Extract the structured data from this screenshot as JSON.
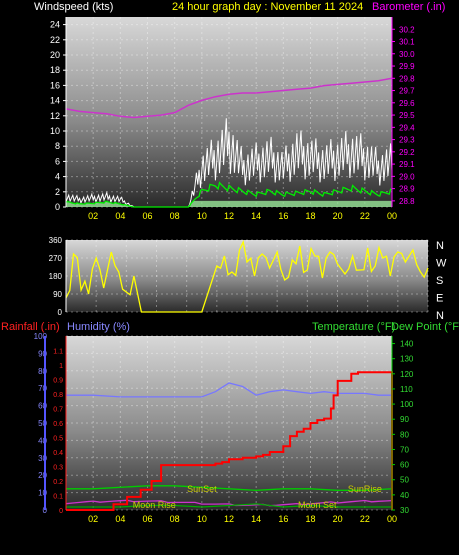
{
  "header": {
    "wind_label": "Windspeed (kts)",
    "title": "24 hour graph day : November 11 2024",
    "baro_label": "Barometer (.in)"
  },
  "bottom_labels": {
    "rainfall": "Rainfall (.in)",
    "humidity": "Humidity (%)",
    "temperature": "Temperature (°F)",
    "dewpoint": "Dew Point (°F)"
  },
  "colors": {
    "wind_gust": "#ffffff",
    "wind_avg": "#00ee00",
    "wind_fill": "#99e699",
    "baro": "#cc33cc",
    "direction": "#ffff00",
    "rain": "#ff0000",
    "humidity": "#7777ff",
    "temperature": "#00cc00",
    "dewpoint": "#00aa00",
    "lunar": "#cc33cc",
    "time_labels": "#ffff00"
  },
  "chart_data": [
    {
      "type": "line",
      "title": "24 hour graph day : November 11 2024",
      "x_ticks": [
        "02",
        "04",
        "06",
        "08",
        "10",
        "12",
        "14",
        "16",
        "18",
        "20",
        "22",
        "00"
      ],
      "left_axis": {
        "label": "Windspeed (kts)",
        "ylim": [
          0,
          25
        ],
        "ticks": [
          0,
          2,
          4,
          6,
          8,
          10,
          12,
          14,
          16,
          18,
          20,
          22,
          24
        ]
      },
      "right_axis": {
        "label": "Barometer (.in)",
        "ylim": [
          28.75,
          30.3
        ],
        "ticks": [
          28.8,
          28.9,
          29.0,
          29.1,
          29.2,
          29.3,
          29.4,
          29.5,
          29.6,
          29.7,
          29.8,
          29.9,
          30.0,
          30.1,
          30.2
        ]
      },
      "series": [
        {
          "name": "Barometer (.in)",
          "axis": "right",
          "x": [
            0,
            1,
            2,
            3,
            4,
            5,
            6,
            7,
            8,
            9,
            10,
            11,
            12,
            13,
            14,
            15,
            16,
            17,
            18,
            19,
            20,
            21,
            22,
            23,
            24
          ],
          "values": [
            29.55,
            29.53,
            29.52,
            29.51,
            29.49,
            29.48,
            29.49,
            29.5,
            29.52,
            29.58,
            29.62,
            29.65,
            29.67,
            29.68,
            29.68,
            29.69,
            29.7,
            29.71,
            29.72,
            29.74,
            29.75,
            29.76,
            29.77,
            29.78,
            29.8
          ]
        },
        {
          "name": "Windspeed gust (kts)",
          "axis": "left",
          "x": [
            0,
            1,
            2,
            3,
            4,
            5,
            6,
            7,
            8,
            9,
            10,
            11,
            12,
            13,
            14,
            15,
            16,
            17,
            18,
            19,
            20,
            21,
            22,
            23,
            24
          ],
          "values": [
            2,
            1.5,
            1.8,
            2,
            1.5,
            0,
            0,
            0,
            0,
            0,
            8,
            10,
            13,
            8,
            9,
            10,
            8,
            11,
            10,
            9,
            10,
            11,
            10,
            8,
            9
          ]
        },
        {
          "name": "Windspeed avg (kts)",
          "axis": "left",
          "x": [
            0,
            1,
            2,
            3,
            4,
            5,
            6,
            7,
            8,
            9,
            10,
            11,
            12,
            13,
            14,
            15,
            16,
            17,
            18,
            19,
            20,
            21,
            22,
            23,
            24
          ],
          "values": [
            0.8,
            0.5,
            0.6,
            0.8,
            0.5,
            0,
            0,
            0,
            0,
            0,
            2.5,
            3.5,
            3,
            2.5,
            2,
            2.5,
            2,
            2.2,
            2.5,
            2,
            2.5,
            3,
            2.5,
            2,
            2.5
          ]
        }
      ]
    },
    {
      "type": "line",
      "x_ticks": [
        "02",
        "04",
        "06",
        "08",
        "10",
        "12",
        "14",
        "16",
        "18",
        "20",
        "22",
        "00"
      ],
      "left_axis": {
        "label": "",
        "ylim": [
          0,
          360
        ],
        "ticks": [
          0,
          90,
          180,
          270,
          360
        ]
      },
      "right_labels": [
        "N",
        "W",
        "S",
        "E",
        "N"
      ],
      "series": [
        {
          "name": "Wind direction",
          "x": [
            0,
            0.5,
            1,
            1.5,
            2,
            2.5,
            3,
            3.5,
            4,
            4.5,
            5,
            5.5,
            6,
            7,
            8,
            9,
            10,
            10.5,
            11,
            11.5,
            12,
            12.5,
            13,
            13.5,
            14,
            14.5,
            15,
            15.5,
            16,
            16.5,
            17,
            17.5,
            18,
            18.5,
            19,
            19.5,
            20,
            20.5,
            21,
            21.5,
            22,
            22.5,
            23,
            23.5,
            24
          ],
          "values": [
            70,
            290,
            110,
            90,
            270,
            120,
            300,
            200,
            100,
            180,
            0,
            0,
            0,
            0,
            0,
            0,
            230,
            280,
            200,
            310,
            250,
            180,
            290,
            220,
            300,
            160,
            260,
            330,
            210,
            280,
            170,
            300,
            240,
            190,
            280,
            210,
            320,
            230,
            270,
            180,
            300,
            250,
            310,
            200,
            220
          ]
        }
      ]
    },
    {
      "type": "line",
      "x_ticks": [
        "02",
        "04",
        "06",
        "08",
        "10",
        "12",
        "14",
        "16",
        "18",
        "20",
        "22",
        "00"
      ],
      "rain_axis": {
        "label": "Rainfall (.in)",
        "ylim": [
          0,
          1.2
        ],
        "ticks": [
          0,
          0.1,
          0.2,
          0.3,
          0.4,
          0.5,
          0.6,
          0.7,
          0.8,
          0.9,
          1.0,
          1.1
        ]
      },
      "humidity_axis": {
        "label": "Humidity (%)",
        "ylim": [
          0,
          100
        ],
        "ticks": [
          0,
          10,
          20,
          30,
          40,
          50,
          60,
          70,
          80,
          90,
          100
        ]
      },
      "temp_axis": {
        "label": "Temperature (°F)",
        "ylim": [
          30,
          145
        ],
        "ticks": [
          30,
          40,
          50,
          60,
          70,
          80,
          90,
          100,
          110,
          120,
          130,
          140
        ]
      },
      "annotations": [
        {
          "text": "Moon Rise",
          "x": 6.5
        },
        {
          "text": "SunSet",
          "x": 10
        },
        {
          "text": "Moon Set",
          "x": 18.5
        },
        {
          "text": "SunRise",
          "x": 22
        }
      ],
      "series": [
        {
          "name": "Humidity (%)",
          "axis": "humidity",
          "x": [
            0,
            2,
            4,
            6,
            8,
            10,
            11,
            12,
            13,
            14,
            15,
            16,
            17,
            18,
            19,
            20,
            21,
            22,
            23,
            24
          ],
          "values": [
            66,
            66,
            65,
            65,
            65,
            65,
            68,
            73,
            71,
            66,
            68,
            69,
            68,
            67,
            68,
            67,
            67,
            67,
            66,
            66
          ]
        },
        {
          "name": "Temperature (°F)",
          "axis": "temp",
          "x": [
            0,
            2,
            4,
            6,
            8,
            10,
            12,
            14,
            16,
            18,
            20,
            22,
            24
          ],
          "values": [
            44,
            44,
            45,
            46,
            46,
            45,
            44,
            43,
            44,
            44,
            43,
            43,
            44
          ]
        },
        {
          "name": "Dew Point (°F)",
          "axis": "temp",
          "x": [
            0,
            2,
            4,
            6,
            8,
            10,
            12,
            14,
            16,
            18,
            20,
            22,
            24
          ],
          "values": [
            32,
            32,
            32,
            33,
            33,
            32,
            33,
            34,
            32,
            33,
            32,
            32,
            32
          ]
        },
        {
          "name": "Rainfall (.in)",
          "axis": "rain",
          "x": [
            2.7,
            3.5,
            4.5,
            5.5,
            6.3,
            7,
            7.5,
            9,
            10,
            11,
            11.5,
            12,
            13,
            14,
            14.5,
            15,
            16,
            16.5,
            17,
            17.5,
            18,
            18.5,
            19,
            19.5,
            19.7,
            20,
            21,
            21.5,
            22,
            23,
            24
          ],
          "values": [
            0,
            0.04,
            0.09,
            0.14,
            0.2,
            0.31,
            0.31,
            0.31,
            0.31,
            0.32,
            0.33,
            0.35,
            0.36,
            0.37,
            0.38,
            0.4,
            0.44,
            0.51,
            0.54,
            0.56,
            0.6,
            0.62,
            0.63,
            0.7,
            0.79,
            0.89,
            0.94,
            0.95,
            0.95,
            0.95,
            0.95
          ]
        }
      ]
    }
  ]
}
